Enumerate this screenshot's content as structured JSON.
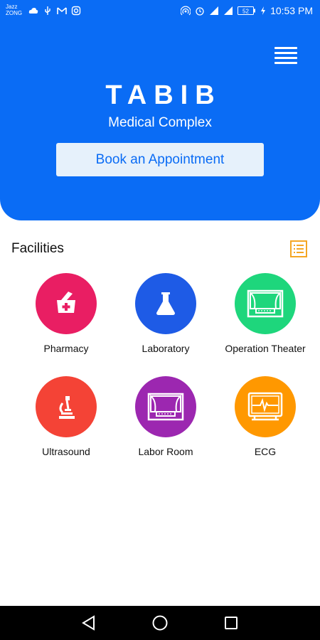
{
  "status_bar": {
    "carrier_line1": "Jazz",
    "carrier_line2": "ZONG",
    "battery": "52",
    "time": "10:53 PM",
    "left_icons": [
      "cloud-icon",
      "usb-icon",
      "gmail-icon",
      "instagram-icon"
    ],
    "right_icons": [
      "hotspot-icon",
      "alarm-icon",
      "signal-icon",
      "signal-icon",
      "battery-icon",
      "charging-icon"
    ]
  },
  "header": {
    "title": "TABIB",
    "subtitle": "Medical Complex",
    "book_button_label": "Book an Appointment",
    "menu_icon": "hamburger-menu-icon",
    "background_color": "#0a6cf5"
  },
  "facilities": {
    "section_title": "Facilities",
    "list_icon": "list-view-icon",
    "list_icon_color": "#f5a623",
    "items": [
      {
        "label": "Pharmacy",
        "icon": "pharmacy-icon",
        "color": "#e91e63"
      },
      {
        "label": "Laboratory",
        "icon": "flask-icon",
        "color": "#1e5be6"
      },
      {
        "label": "Operation Theater",
        "icon": "theater-icon",
        "color": "#1ed67c"
      },
      {
        "label": "Ultrasound",
        "icon": "microscope-icon",
        "color": "#f44336"
      },
      {
        "label": "Labor Room",
        "icon": "stage-curtain-icon",
        "color": "#9c27b0"
      },
      {
        "label": "ECG",
        "icon": "ecg-monitor-icon",
        "color": "#ff9800"
      }
    ]
  },
  "nav_bar": {
    "back_icon": "back-triangle-icon",
    "home_icon": "home-circle-icon",
    "recents_icon": "recents-square-icon"
  }
}
